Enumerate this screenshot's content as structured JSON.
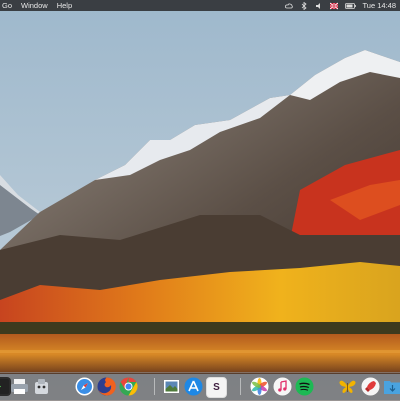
{
  "menubar": {
    "items": [
      "Go",
      "Window",
      "Help"
    ],
    "time": "Tue 14:48",
    "status_icons": [
      "creative-cloud-icon",
      "bluetooth-icon",
      "volume-icon",
      "flag-icon",
      "battery-icon"
    ]
  },
  "dock": {
    "apps": [
      {
        "name": "Terminal",
        "icon": "terminal-icon",
        "color": "#2b2b2b"
      },
      {
        "name": "Printer",
        "icon": "printer-icon",
        "color": "#b7bcc4"
      },
      {
        "name": "Automator",
        "icon": "automator-icon",
        "color": "#d9dde3"
      },
      {
        "name": "Safari",
        "icon": "safari-icon",
        "color": "#3a8ee6"
      },
      {
        "name": "Firefox",
        "icon": "firefox-icon",
        "color": "#f0611e"
      },
      {
        "name": "Chrome",
        "icon": "chrome-icon",
        "color": "#e8453c"
      },
      {
        "name": "Preview",
        "icon": "preview-icon",
        "color": "#7f9ab8"
      },
      {
        "name": "App Store",
        "icon": "app-store-icon",
        "color": "#1e88e5"
      },
      {
        "name": "Slack",
        "icon": "slack-icon",
        "color": "#f4f4f4",
        "label": "S"
      },
      {
        "name": "Photos",
        "icon": "photos-icon",
        "color": "#f7f7f7"
      },
      {
        "name": "iTunes",
        "icon": "itunes-icon",
        "color": "#f3f3f3"
      },
      {
        "name": "Spotify",
        "icon": "spotify-icon",
        "color": "#1db954"
      },
      {
        "name": "Tes",
        "icon": "butterfly-icon",
        "color": "#f2b300"
      },
      {
        "name": "Shuttle",
        "icon": "rocket-icon",
        "color": "#e03a3a"
      },
      {
        "name": "Downloads",
        "icon": "downloads-folder-icon",
        "color": "#4aa3df"
      }
    ]
  },
  "colors": {
    "menubar_bg": "#2a2a2c",
    "dock_bg": "#463e3c"
  }
}
